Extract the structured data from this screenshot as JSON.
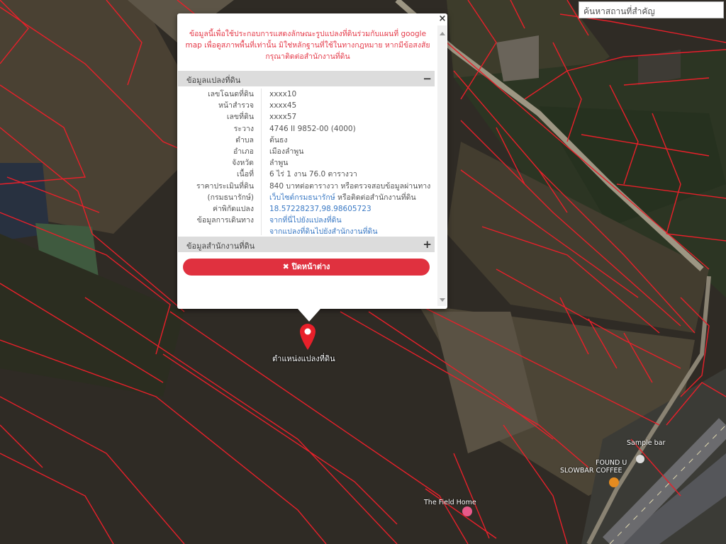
{
  "search": {
    "placeholder": "ค้นหาสถานที่สำคัญ"
  },
  "popup": {
    "close_glyph": "×",
    "notice": "ข้อมูลนี้เพื่อใช้ประกอบการแสดงลักษณะรูปแปลงที่ดินร่วมกับแผนที่ google map เพื่อดูสภาพพื้นที่เท่านั้น มิใช่หลักฐานที่ใช้ในทางกฎหมาย หากมีข้อสงสัยกรุณาติดต่อสำนักงานที่ดิน",
    "land_section": {
      "title": "ข้อมูลแปลงที่ดิน",
      "toggle": "−"
    },
    "rows": [
      {
        "key": "เลขโฉนดที่ดิน",
        "value": "xxxx10"
      },
      {
        "key": "หน้าสำรวจ",
        "value": "xxxx45"
      },
      {
        "key": "เลขที่ดิน",
        "value": "xxxx57"
      },
      {
        "key": "ระวาง",
        "value": "4746 II 9852-00 (4000)"
      },
      {
        "key": "ตำบล",
        "value": "ต้นธง"
      },
      {
        "key": "อำเภอ",
        "value": "เมืองลำพูน"
      },
      {
        "key": "จังหวัด",
        "value": "ลำพูน"
      },
      {
        "key": "เนื้อที่",
        "value": "6 ไร่ 1 งาน 76.0 ตารางวา"
      },
      {
        "key": "ราคาประเมินที่ดิน",
        "value": "840 บาทต่อตารางวา หรือตรวจสอบข้อมูลผ่านทาง"
      },
      {
        "key": "(กรมธนารักษ์)",
        "value": "เว็บไซต์กรมธนารักษ์",
        "value2": " หรือติดต่อสำนักงานที่ดิน"
      },
      {
        "key": "ค่าพิกัดแปลง",
        "value": "18.57228237,98.98605723"
      },
      {
        "key": "ข้อมูลการเดินทาง",
        "value": "จากที่นี่ไปยังแปลงที่ดิน"
      },
      {
        "key": "",
        "value": "จากแปลงที่ดินไปยังสำนักงานที่ดิน"
      }
    ],
    "office_section": {
      "title": "ข้อมูลสำนักงานที่ดิน",
      "toggle": "+"
    },
    "close_button": {
      "icon": "✖",
      "label": "ปิดหน้าต่าง"
    }
  },
  "map": {
    "pin_label": "ตำแหน่งแปลงที่ดิน",
    "pois": [
      {
        "name": "The Field Home"
      },
      {
        "name": "Sample bar"
      },
      {
        "name": "FOUND U"
      },
      {
        "name": "SLOWBAR COFFEE"
      }
    ],
    "colors": {
      "parcel_line": "#e8202a",
      "pin": "#e8202a",
      "link": "#3a79c4"
    }
  }
}
